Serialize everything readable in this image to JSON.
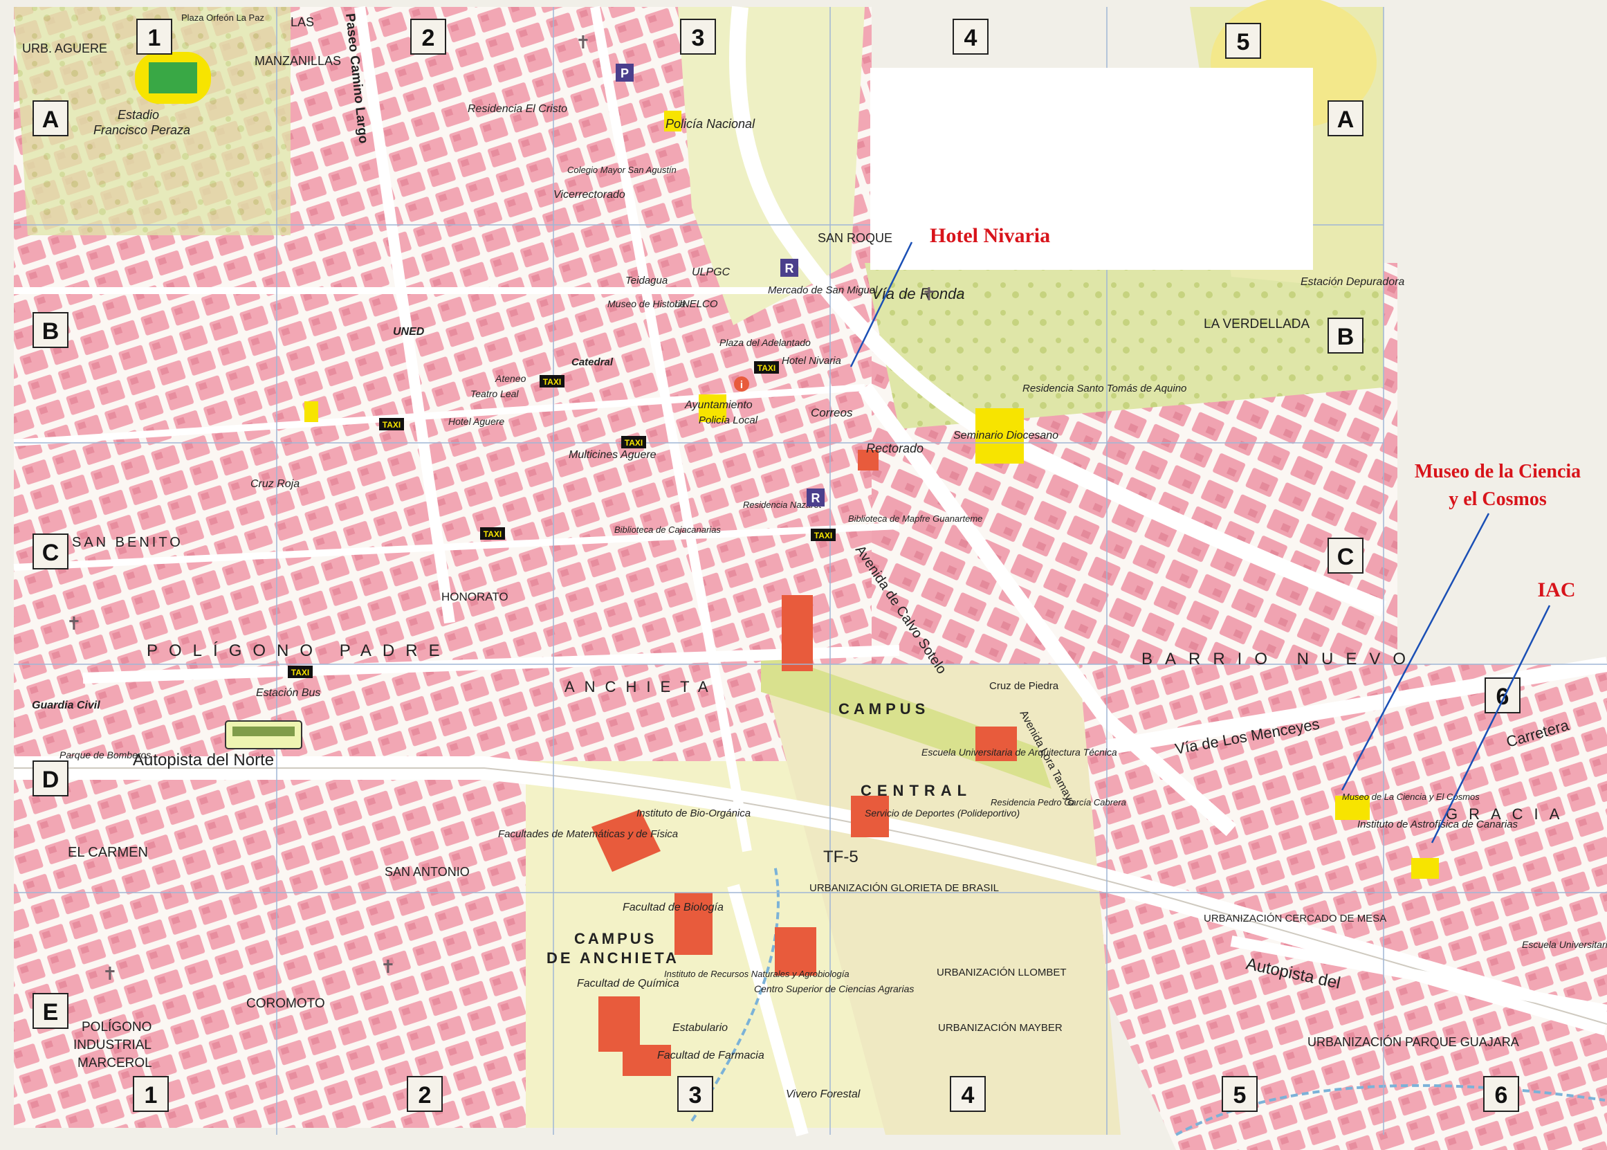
{
  "grid": {
    "columns": [
      "1",
      "2",
      "3",
      "4",
      "5",
      "6"
    ],
    "rows": [
      "A",
      "B",
      "C",
      "D",
      "E"
    ]
  },
  "callouts": {
    "hotel": "Hotel Nivaria",
    "museo_line1": "Museo de la Ciencia",
    "museo_line2": "y el Cosmos",
    "iac": "IAC"
  },
  "labels": {
    "urb_aguere": "URB. AGUERE",
    "las_manzanillas_1": "LAS",
    "las_manzanillas_2": "MANZANILLAS",
    "estadio_1": "Estadio",
    "estadio_2": "Francisco Peraza",
    "plaza_orfeon": "Plaza Orfeón La Paz",
    "paseo_camino_largo": "Paseo Camino Largo",
    "residencia_cristo": "Residencia El Cristo",
    "policia_nacional": "Policía Nacional",
    "colegio_mayor": "Colegio Mayor San Agustín",
    "vicerrectorado": "Vicerrectorado",
    "san_roque": "SAN ROQUE",
    "via_ronda": "Vía de Ronda",
    "ulpgc": "ULPGC",
    "teidagua": "Teidagua",
    "museo_historia": "Museo de Historia",
    "unelco": "UNELCO",
    "mercado": "Mercado de San Miguel",
    "plaza_adelantado": "Plaza del Adelantado",
    "hotel_nivaria_map": "Hotel Nivaria",
    "uned": "UNED",
    "catedral": "Catedral",
    "ateneo": "Ateneo",
    "teatro_leal": "Teatro Leal",
    "hotel_aguere": "Hotel Aguere",
    "ayuntamiento": "Ayuntamiento",
    "policia_local": "Policía Local",
    "correos": "Correos",
    "rectorado": "Rectorado",
    "seminario": "Seminario Diocesano",
    "residencia_tomas": "Residencia Santo Tomás de Aquino",
    "estacion_depuradora": "Estación Depuradora",
    "la_verdellada": "LA VERDELLADA",
    "multicines": "Multicines Aguere",
    "cruz_roja": "Cruz Roja",
    "san_benito": "SAN BENITO",
    "biblioteca_caja": "Biblioteca de Cajacanarias",
    "biblioteca_mapfre": "Biblioteca de Mapfre Guanarteme",
    "residencia_nazaret": "Residencia Nazaret",
    "avenida_calvo": "Avenida de Calvo Sotelo",
    "poligono_padre": "POLÍGONO PADRE",
    "anchieta": "ANCHIETA",
    "estacion_bus": "Estación Bus",
    "guardia_civil": "Guardia Civil",
    "parque_bomberos": "Parque de Bomberos",
    "autopista_norte": "Autopista del Norte",
    "el_carmen": "EL CARMEN",
    "san_antonio": "SAN ANTONIO",
    "honorato": "HONORATO",
    "campus_central_1": "CAMPUS",
    "campus_central_2": "CENTRAL",
    "escuela_arquitectura": "Escuela Universitaria de Arquitectura Técnica",
    "servicio_deportes": "Servicio de Deportes (Polideportivo)",
    "residencia_pedro": "Residencia Pedro García Cabrera",
    "instituto_bio": "Instituto de Bio-Orgánica",
    "fac_matematicas": "Facultades de Matemáticas y de Física",
    "fac_biologia": "Facultad de Biología",
    "campus_anchieta_1": "CAMPUS",
    "campus_anchieta_2": "DE ANCHIETA",
    "fac_quimica": "Facultad de Química",
    "fac_farmacia": "Facultad de Farmacia",
    "estabulario": "Estabulario",
    "instituto_recursos": "Instituto de Recursos Naturales y Agrobiología",
    "centro_agrarias": "Centro Superior de Ciencias Agrarias",
    "urb_glorieta": "URBANIZACIÓN GLORIETA DE BRASIL",
    "urb_llombet": "URBANIZACIÓN LLOMBET",
    "urb_mayber": "URBANIZACIÓN MAYBER",
    "urb_cercado": "URBANIZACIÓN CERCADO DE MESA",
    "urb_parque": "URBANIZACIÓN PARQUE GUAJARA",
    "tf5": "TF-5",
    "coromoto": "COROMOTO",
    "poligono_marcerol_1": "POLÍGONO",
    "poligono_marcerol_2": "INDUSTRIAL",
    "poligono_marcerol_3": "MARCEROL",
    "vivero": "Vivero Forestal",
    "barrio_nuevo": "BARRIO NUEVO",
    "museo_map": "Museo de La Ciencia y El Cosmos",
    "instituto_astro": "Instituto de Astrofísica de Canarias",
    "gracia": "GRACIA",
    "carretera": "Carretera",
    "escuela_empresariales": "Escuela Universitaria de C.C. Empresariales",
    "via_menceyes": "Vía de Los Menceyes",
    "avenida_lora": "Avenida Lora Tamayo",
    "cruz_piedra": "Cruz de Piedra",
    "autopista_del": "Autopista del"
  },
  "colors": {
    "block": "#f2a7b4",
    "block_dark": "#e78d9e",
    "street": "#fdfcfa",
    "green": "#c8d68a",
    "park": "#e9eab0",
    "yellow": "#f7e400",
    "red_building": "#e85b3c",
    "callout_text": "#d8141b",
    "callout_line": "#1a4fb5",
    "gridline": "#9fb6d6"
  },
  "legend_box_blank": true
}
